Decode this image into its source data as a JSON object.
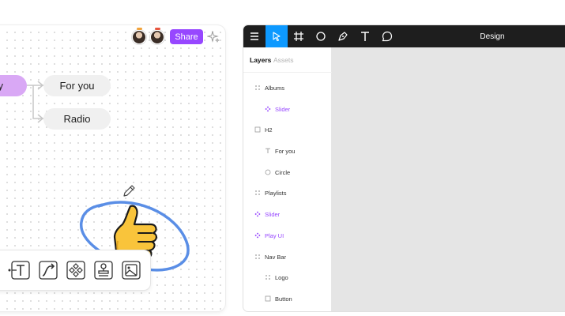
{
  "board": {
    "share_label": "Share",
    "nodes": {
      "play": "ay",
      "for_you": "For you",
      "radio": "Radio"
    },
    "icons": [
      "avatar-1",
      "avatar-2",
      "sparkle-icon",
      "pencil-icon",
      "thumbs-up-emoji"
    ],
    "toolbar_tools": [
      "connector-icon",
      "text-tool-icon",
      "path-tool-icon",
      "component-icon",
      "stamp-icon",
      "image-icon"
    ],
    "colors": {
      "share": "#9747ff",
      "play_node": "#d9a8f5",
      "lasso": "#5a8ee6",
      "avatar_dot_1": "#f2a33a",
      "avatar_dot_2": "#e8553e"
    }
  },
  "figma": {
    "title": "Design",
    "tools": [
      "menu-icon",
      "move-tool-icon",
      "frame-tool-icon",
      "ellipse-tool-icon",
      "pen-tool-icon",
      "text-tool-icon",
      "comment-tool-icon"
    ],
    "active_tool": "move-tool-icon",
    "tabs": {
      "layers": "Layers",
      "assets": "Assets"
    },
    "layers": [
      {
        "name": "Albums",
        "icon": "grid",
        "indent": 1,
        "purple": false
      },
      {
        "name": "Slider",
        "icon": "component",
        "indent": 2,
        "purple": true
      },
      {
        "name": "H2",
        "icon": "frame",
        "indent": 1,
        "purple": false
      },
      {
        "name": "For you",
        "icon": "text",
        "indent": 2,
        "purple": false
      },
      {
        "name": "Circle",
        "icon": "circle",
        "indent": 2,
        "purple": false
      },
      {
        "name": "Playlists",
        "icon": "grid",
        "indent": 1,
        "purple": false
      },
      {
        "name": "Slider",
        "icon": "component",
        "indent": 1,
        "purple": true
      },
      {
        "name": "Play UI",
        "icon": "component",
        "indent": 1,
        "purple": true
      },
      {
        "name": "Nav Bar",
        "icon": "grid",
        "indent": 1,
        "purple": false
      },
      {
        "name": "Logo",
        "icon": "grid",
        "indent": 2,
        "purple": false
      },
      {
        "name": "Button",
        "icon": "frame",
        "indent": 2,
        "purple": false
      }
    ],
    "colors": {
      "topbar": "#1e1e1e",
      "active_tool": "#0d99ff",
      "component": "#9747ff"
    }
  }
}
